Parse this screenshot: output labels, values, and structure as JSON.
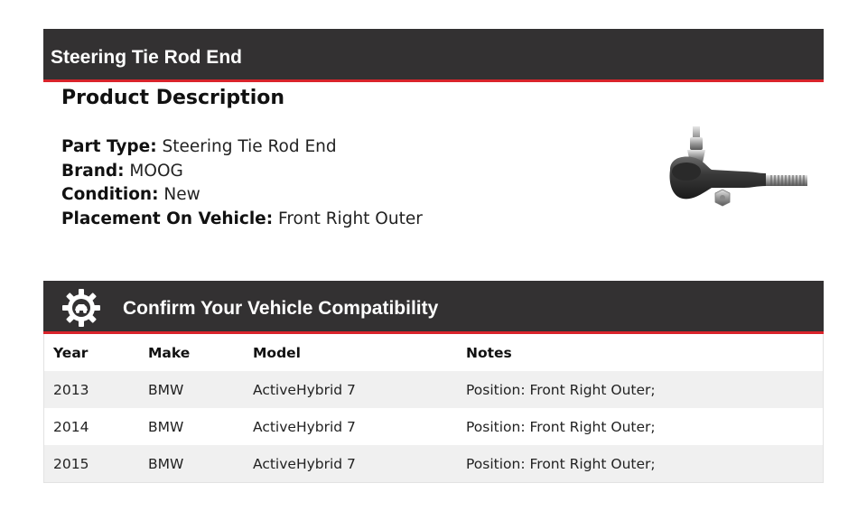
{
  "header": {
    "title": "Steering Tie Rod End"
  },
  "description": {
    "heading": "Product Description",
    "specs": [
      {
        "label": "Part Type:",
        "value": "Steering Tie Rod End"
      },
      {
        "label": "Brand:",
        "value": "MOOG"
      },
      {
        "label": "Condition:",
        "value": "New"
      },
      {
        "label": "Placement On Vehicle:",
        "value": "Front Right Outer"
      }
    ],
    "image_icon": "tie-rod-end-photo"
  },
  "compatibility": {
    "title": "Confirm Your Vehicle Compatibility",
    "icon": "gear-car-icon",
    "columns": [
      "Year",
      "Make",
      "Model",
      "Notes"
    ],
    "rows": [
      [
        "2013",
        "BMW",
        "ActiveHybrid 7",
        "Position: Front Right Outer;"
      ],
      [
        "2014",
        "BMW",
        "ActiveHybrid 7",
        "Position: Front Right Outer;"
      ],
      [
        "2015",
        "BMW",
        "ActiveHybrid 7",
        "Position: Front Right Outer;"
      ]
    ]
  },
  "colors": {
    "bar": "#333132",
    "accent": "#d9242b",
    "row_stripe": "#f0f0f0"
  }
}
